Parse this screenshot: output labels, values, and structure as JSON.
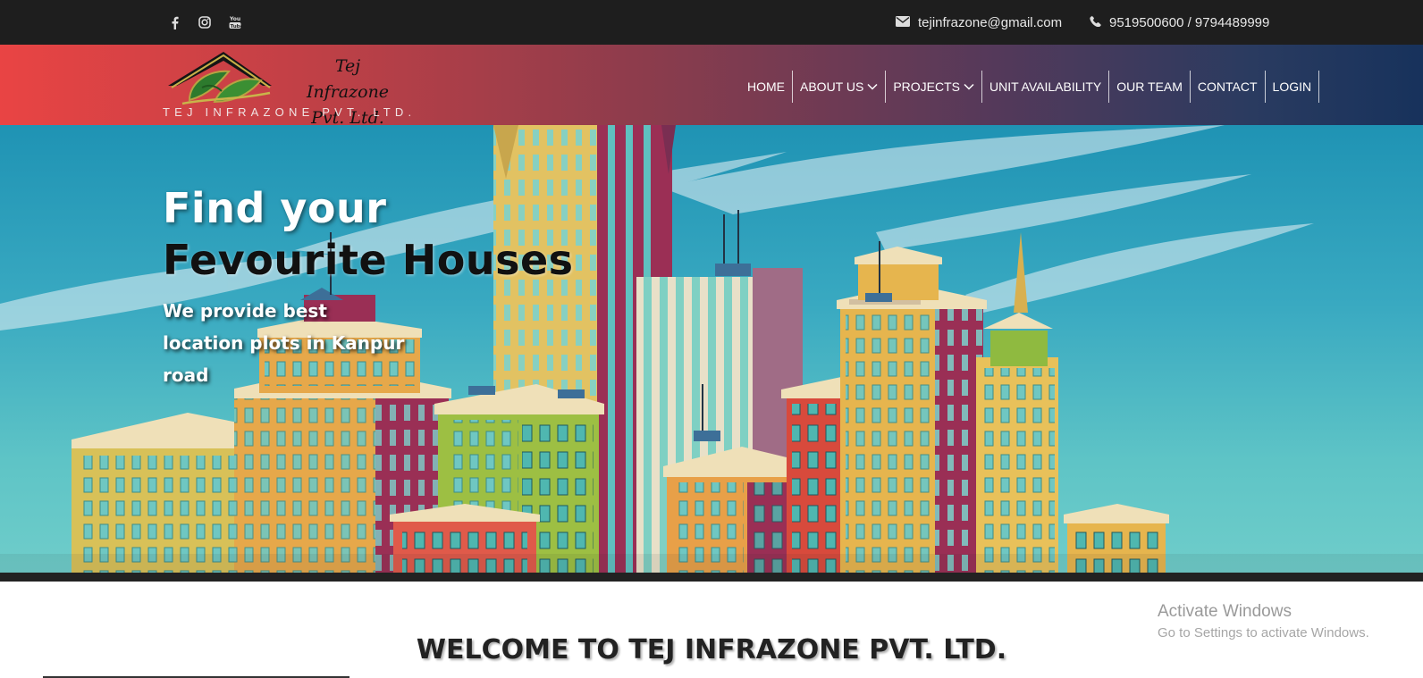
{
  "topbar": {
    "social": [
      {
        "icon": "facebook-icon"
      },
      {
        "icon": "instagram-icon"
      },
      {
        "icon": "youtube-icon"
      }
    ],
    "email": "tejinfrazone@gmail.com",
    "phone": "9519500600 / 9794489999"
  },
  "header": {
    "logo_script_1": "Tej Infrazone",
    "logo_script_2": "Pvt. Ltd.",
    "logo_subtitle": "TEJ INFRAZONE PVT. LTD.",
    "nav": [
      {
        "label": "HOME"
      },
      {
        "label": "ABOUT US",
        "dropdown": true
      },
      {
        "label": "PROJECTS",
        "dropdown": true
      },
      {
        "label": "UNIT AVAILABILITY"
      },
      {
        "label": "OUR TEAM"
      },
      {
        "label": "CONTACT"
      },
      {
        "label": "LOGIN"
      }
    ]
  },
  "hero": {
    "title_line1": "Find your",
    "title_line2": "Fevourite Houses",
    "subtitle": "We provide best location plots in Kanpur road"
  },
  "welcome": {
    "heading": "WELCOME TO TEJ INFRAZONE PVT. LTD."
  },
  "watermark": {
    "title": "Activate Windows",
    "subtitle": "Go to Settings to activate Windows."
  },
  "colors": {
    "topbar_bg": "#1e1e1e",
    "header_gradient_start": "#e94444",
    "header_gradient_end": "#17325c",
    "sky": "#39a9c1"
  }
}
